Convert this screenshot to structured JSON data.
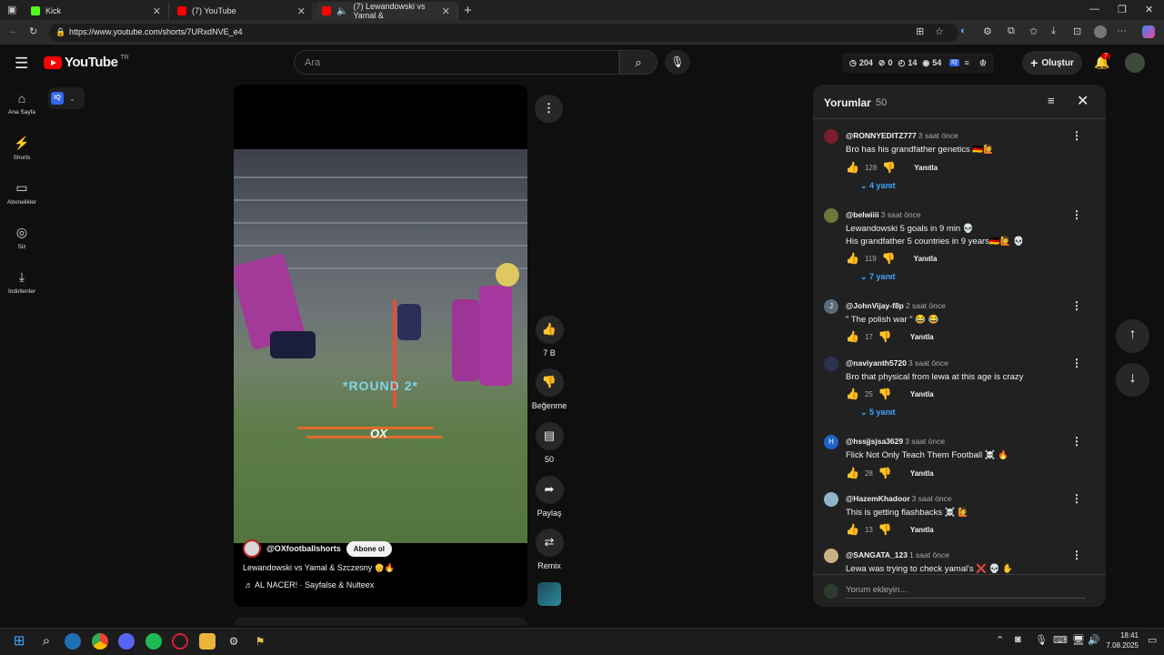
{
  "browser": {
    "tabs": [
      {
        "title": "Kick",
        "icon": "kick-icon",
        "color": "#53fc18"
      },
      {
        "title": "(7) YouTube",
        "icon": "youtube-icon",
        "color": "#ff0000"
      },
      {
        "title": "(7) Lewandowski vs Yamal &",
        "icon": "youtube-icon",
        "color": "#ff0000"
      }
    ],
    "url": "https://www.youtube.com/shorts/7URxdNVE_e4"
  },
  "header": {
    "logo_text": "YouTube",
    "country": "TR",
    "search_placeholder": "Ara",
    "ext_stats": {
      "a": "204",
      "b": "0",
      "c": "14",
      "d": "54",
      "iq": "IQ"
    },
    "create_label": "Oluştur",
    "notif_count": "7"
  },
  "sidebar": {
    "items": [
      {
        "label": "Ana Sayfa",
        "icon": "home-icon"
      },
      {
        "label": "Shorts",
        "icon": "shorts-icon"
      },
      {
        "label": "Abonelikler",
        "icon": "subscriptions-icon"
      },
      {
        "label": "Siz",
        "icon": "you-icon"
      },
      {
        "label": "İndirilenler",
        "icon": "download-icon"
      }
    ]
  },
  "iq_badge": "IQ",
  "video": {
    "overlay_round": "*ROUND 2*",
    "overlay_ox": "OX",
    "channel": "@OXfootballshorts",
    "subscribe": "Abone ol",
    "title": "Lewandowski vs Yamal & Szczesny 👴🔥",
    "music": "♬ AL NACER! · Sayfalse & Nulteex"
  },
  "actions": {
    "likes": "7 B",
    "dislike": "Beğenme",
    "comments": "50",
    "share": "Paylaş",
    "remix": "Remix"
  },
  "comments_panel": {
    "title": "Yorumlar",
    "count": "50",
    "add_placeholder": "Yorum ekleyin...",
    "reply_label": "Yanıtla",
    "items": [
      {
        "user": "@RONNYEDITZ777",
        "time": "3 saat önce",
        "text": "Bro has his grandfather genetics 🇩🇪🙋",
        "likes": "128",
        "replies": "4 yanıt",
        "avatar_color": "#7a1f2b"
      },
      {
        "user": "@belwiiii",
        "time": "3 saat önce",
        "text": "Lewandowski  5 goals in 9 min 💀",
        "text2": "His grandfather 5 countries in 9 years🇩🇪🙋 💀",
        "likes": "119",
        "replies": "7 yanıt",
        "avatar_color": "#6b7a3a"
      },
      {
        "user": "@JohnVijay-f8p",
        "time": "2 saat önce",
        "text": "\" The polish war \" 😂 😂",
        "likes": "17",
        "avatar_color": "#5c6b7a",
        "initial": "J"
      },
      {
        "user": "@naviyanth5720",
        "time": "3 saat önce",
        "text": "Bro that physical from lewa at this age is crazy",
        "likes": "25",
        "replies": "5 yanıt",
        "avatar_color": "#2b3350"
      },
      {
        "user": "@hssjjsjsa3629",
        "time": "3 saat önce",
        "text": "Flick Not Only Teach Them Football ☠️ 🔥",
        "likes": "28",
        "avatar_color": "#1e63c9",
        "initial": "H"
      },
      {
        "user": "@HazemKhadoor",
        "time": "3 saat önce",
        "text": "This is getting flashbacks ☠️ 🙋",
        "likes": "13",
        "avatar_color": "#8fb3c9"
      },
      {
        "user": "@SANGATA_123",
        "time": "1 saat önce",
        "text": "Lewa was trying to check yamal's ❌ 💀 ✋",
        "avatar_color": "#c9b080"
      }
    ]
  },
  "taskbar": {
    "time": "18:41",
    "date": "7.08.2025"
  }
}
